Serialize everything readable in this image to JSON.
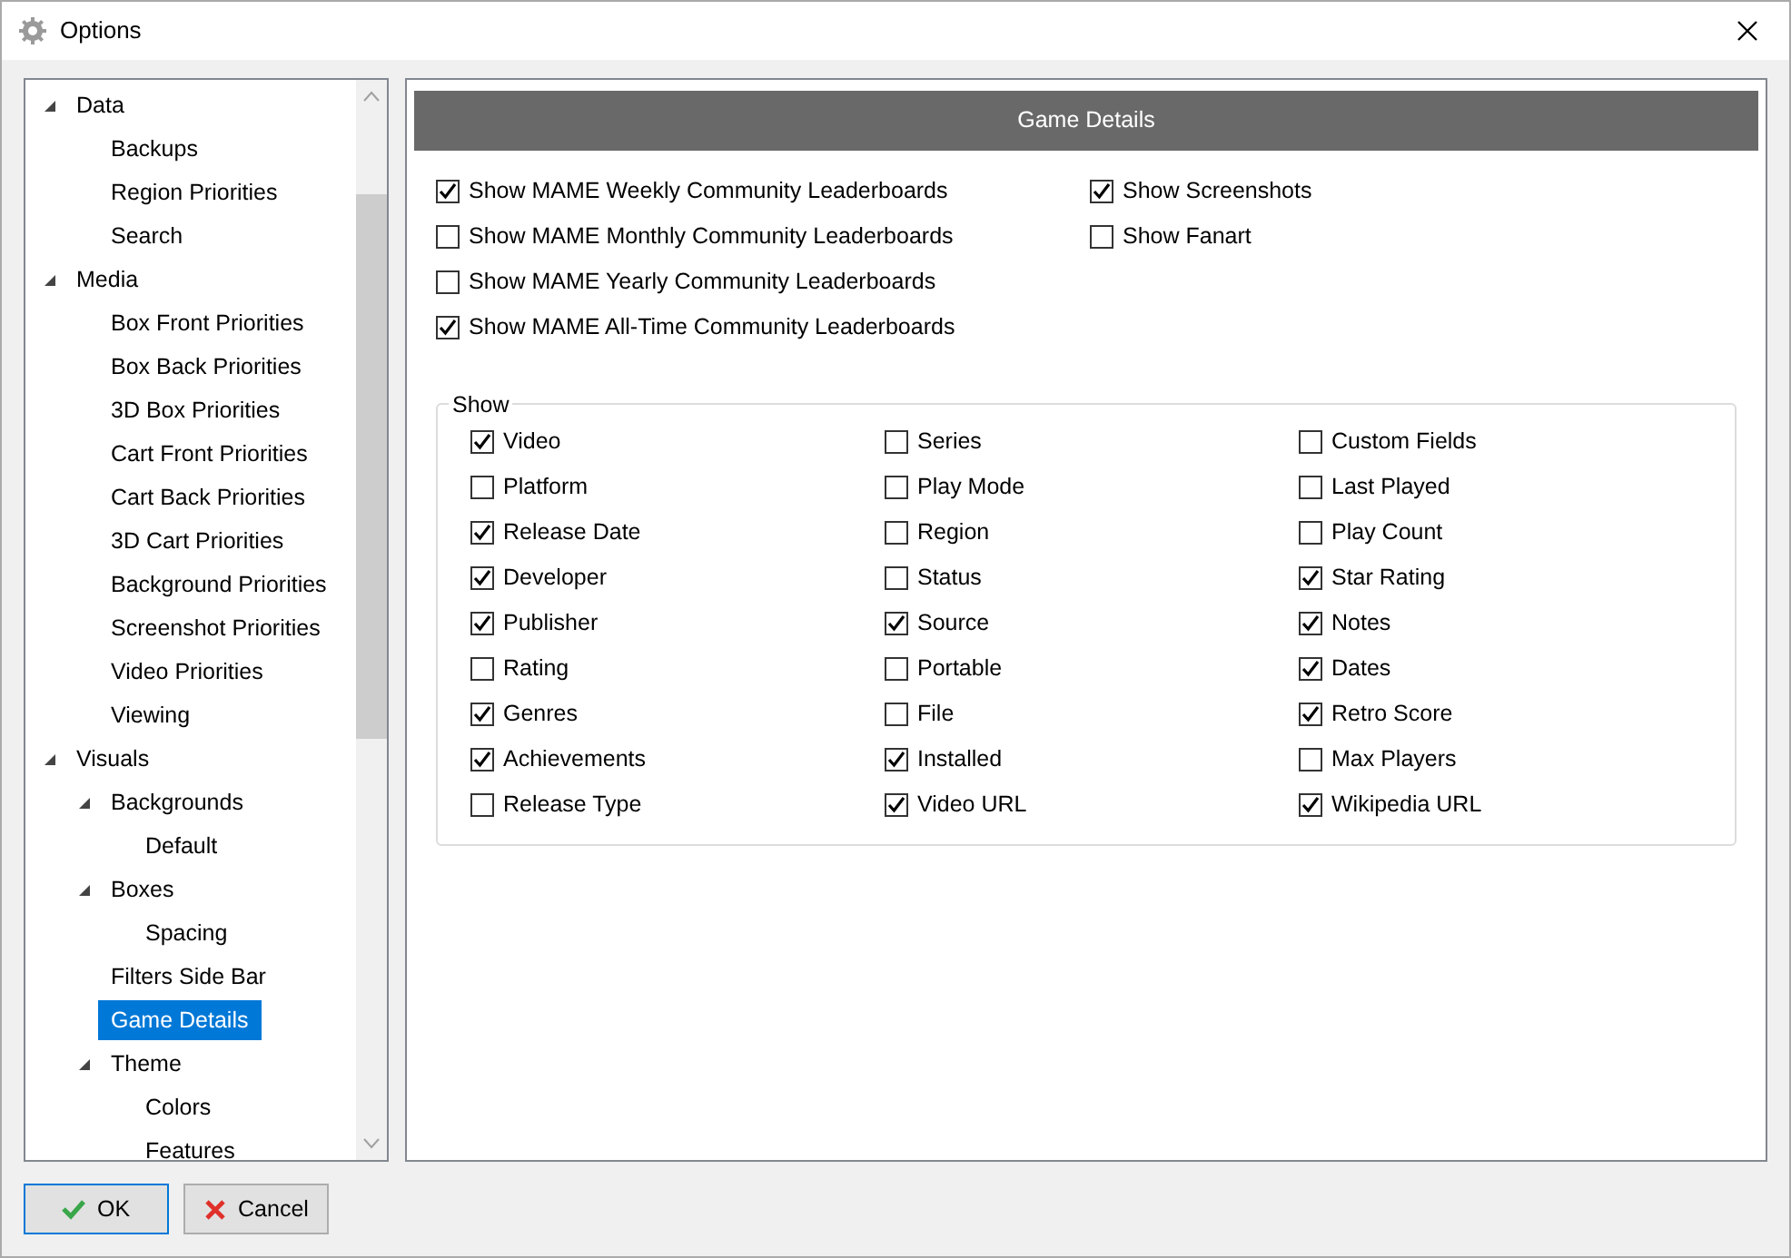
{
  "window": {
    "title": "Options"
  },
  "tree": {
    "items": [
      {
        "label": "Data",
        "expanded": true,
        "selected": false,
        "children": [
          {
            "label": "Backups",
            "selected": false
          },
          {
            "label": "Region Priorities",
            "selected": false
          },
          {
            "label": "Search",
            "selected": false
          }
        ]
      },
      {
        "label": "Media",
        "expanded": true,
        "selected": false,
        "children": [
          {
            "label": "Box Front Priorities",
            "selected": false
          },
          {
            "label": "Box Back Priorities",
            "selected": false
          },
          {
            "label": "3D Box Priorities",
            "selected": false
          },
          {
            "label": "Cart Front Priorities",
            "selected": false
          },
          {
            "label": "Cart Back Priorities",
            "selected": false
          },
          {
            "label": "3D Cart Priorities",
            "selected": false
          },
          {
            "label": "Background Priorities",
            "selected": false
          },
          {
            "label": "Screenshot Priorities",
            "selected": false
          },
          {
            "label": "Video Priorities",
            "selected": false
          },
          {
            "label": "Viewing",
            "selected": false
          }
        ]
      },
      {
        "label": "Visuals",
        "expanded": true,
        "selected": false,
        "children": [
          {
            "label": "Backgrounds",
            "expanded": true,
            "selected": false,
            "children": [
              {
                "label": "Default",
                "selected": false
              }
            ]
          },
          {
            "label": "Boxes",
            "expanded": true,
            "selected": false,
            "children": [
              {
                "label": "Spacing",
                "selected": false
              }
            ]
          },
          {
            "label": "Filters Side Bar",
            "selected": false
          },
          {
            "label": "Game Details",
            "selected": true
          },
          {
            "label": "Theme",
            "expanded": true,
            "selected": false,
            "children": [
              {
                "label": "Colors",
                "selected": false
              },
              {
                "label": "Features",
                "selected": false
              }
            ]
          }
        ]
      }
    ]
  },
  "panel": {
    "title": "Game Details",
    "left_options": [
      {
        "label": "Show MAME Weekly Community Leaderboards",
        "checked": true
      },
      {
        "label": "Show MAME Monthly Community Leaderboards",
        "checked": false
      },
      {
        "label": "Show MAME Yearly Community Leaderboards",
        "checked": false
      },
      {
        "label": "Show MAME All-Time Community Leaderboards",
        "checked": true
      }
    ],
    "right_options": [
      {
        "label": "Show Screenshots",
        "checked": true
      },
      {
        "label": "Show Fanart",
        "checked": false
      }
    ],
    "show_group": {
      "title": "Show",
      "columns": [
        {
          "items": [
            {
              "label": "Video",
              "checked": true
            },
            {
              "label": "Platform",
              "checked": false
            },
            {
              "label": "Release Date",
              "checked": true
            },
            {
              "label": "Developer",
              "checked": true
            },
            {
              "label": "Publisher",
              "checked": true
            },
            {
              "label": "Rating",
              "checked": false
            },
            {
              "label": "Genres",
              "checked": true
            },
            {
              "label": "Achievements",
              "checked": true
            },
            {
              "label": "Release Type",
              "checked": false
            }
          ]
        },
        {
          "items": [
            {
              "label": "Series",
              "checked": false
            },
            {
              "label": "Play Mode",
              "checked": false
            },
            {
              "label": "Region",
              "checked": false
            },
            {
              "label": "Status",
              "checked": false
            },
            {
              "label": "Source",
              "checked": true
            },
            {
              "label": "Portable",
              "checked": false
            },
            {
              "label": "File",
              "checked": false
            },
            {
              "label": "Installed",
              "checked": true
            },
            {
              "label": "Video URL",
              "checked": true
            }
          ]
        },
        {
          "items": [
            {
              "label": "Custom Fields",
              "checked": false
            },
            {
              "label": "Last Played",
              "checked": false
            },
            {
              "label": "Play Count",
              "checked": false
            },
            {
              "label": "Star Rating",
              "checked": true
            },
            {
              "label": "Notes",
              "checked": true
            },
            {
              "label": "Dates",
              "checked": true
            },
            {
              "label": "Retro Score",
              "checked": true
            },
            {
              "label": "Max Players",
              "checked": false
            },
            {
              "label": "Wikipedia URL",
              "checked": true
            }
          ]
        }
      ]
    }
  },
  "buttons": [
    {
      "label": "OK",
      "kind": "ok"
    },
    {
      "label": "Cancel",
      "kind": "cancel"
    }
  ]
}
